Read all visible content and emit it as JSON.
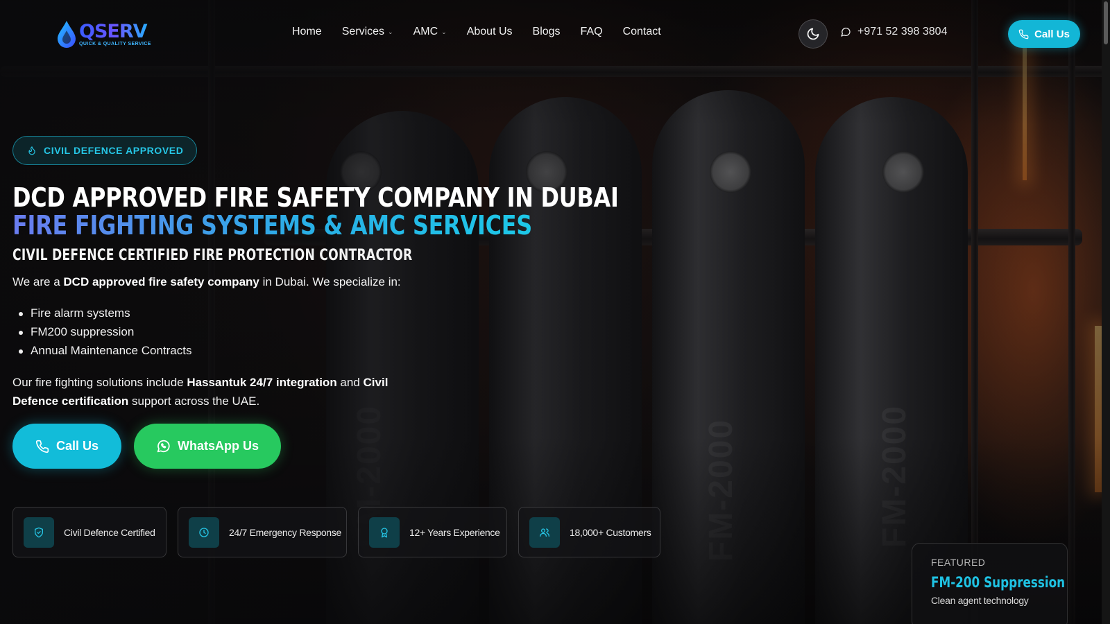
{
  "brand": {
    "logo_word": "QSERV",
    "logo_tagline": "QUICK & QUALITY SERVICE"
  },
  "nav": {
    "items": [
      {
        "label": "Home",
        "has_dropdown": false
      },
      {
        "label": "Services",
        "has_dropdown": true
      },
      {
        "label": "AMC",
        "has_dropdown": true
      },
      {
        "label": "About Us",
        "has_dropdown": false
      },
      {
        "label": "Blogs",
        "has_dropdown": false
      },
      {
        "label": "FAQ",
        "has_dropdown": false
      },
      {
        "label": "Contact",
        "has_dropdown": false
      }
    ]
  },
  "header": {
    "theme_toggle_icon": "moon-icon",
    "phone": "+971 52 398 3804",
    "call_label": "Call Us"
  },
  "hero": {
    "badge": "CIVIL DEFENCE APPROVED",
    "title_line1": "DCD APPROVED FIRE SAFETY COMPANY IN DUBAI",
    "title_line2": "FIRE FIGHTING SYSTEMS & AMC SERVICES",
    "subtitle": "CIVIL DEFENCE CERTIFIED FIRE PROTECTION CONTRACTOR",
    "intro": {
      "pre": "We are a ",
      "bold": "DCD approved fire safety company",
      "post": " in Dubai. We specialize in:"
    },
    "specialties": [
      "Fire alarm systems",
      "FM200 suppression",
      "Annual Maintenance Contracts"
    ],
    "paragraph": {
      "p1": "Our fire fighting solutions include ",
      "b1": "Hassantuk 24/7 integration",
      "p2": " and ",
      "b2": "Civil Defence certification",
      "p3": " support across the UAE."
    },
    "cta_call": "Call Us",
    "cta_whatsapp": "WhatsApp Us"
  },
  "stats": [
    {
      "label": "Civil Defence Certified",
      "icon": "shield-check-icon"
    },
    {
      "label": "24/7 Emergency Response",
      "icon": "clock-icon"
    },
    {
      "label": "12+ Years Experience",
      "icon": "award-icon"
    },
    {
      "label": "18,000+ Customers",
      "icon": "users-icon"
    }
  ],
  "featured": {
    "kicker": "FEATURED",
    "title": "FM-200 Suppression",
    "subtitle": "Clean agent technology"
  },
  "colors": {
    "accent_cyan": "#13b6d6",
    "whatsapp_green": "#27c95f",
    "gradient_blue": "#6a7cf0"
  }
}
